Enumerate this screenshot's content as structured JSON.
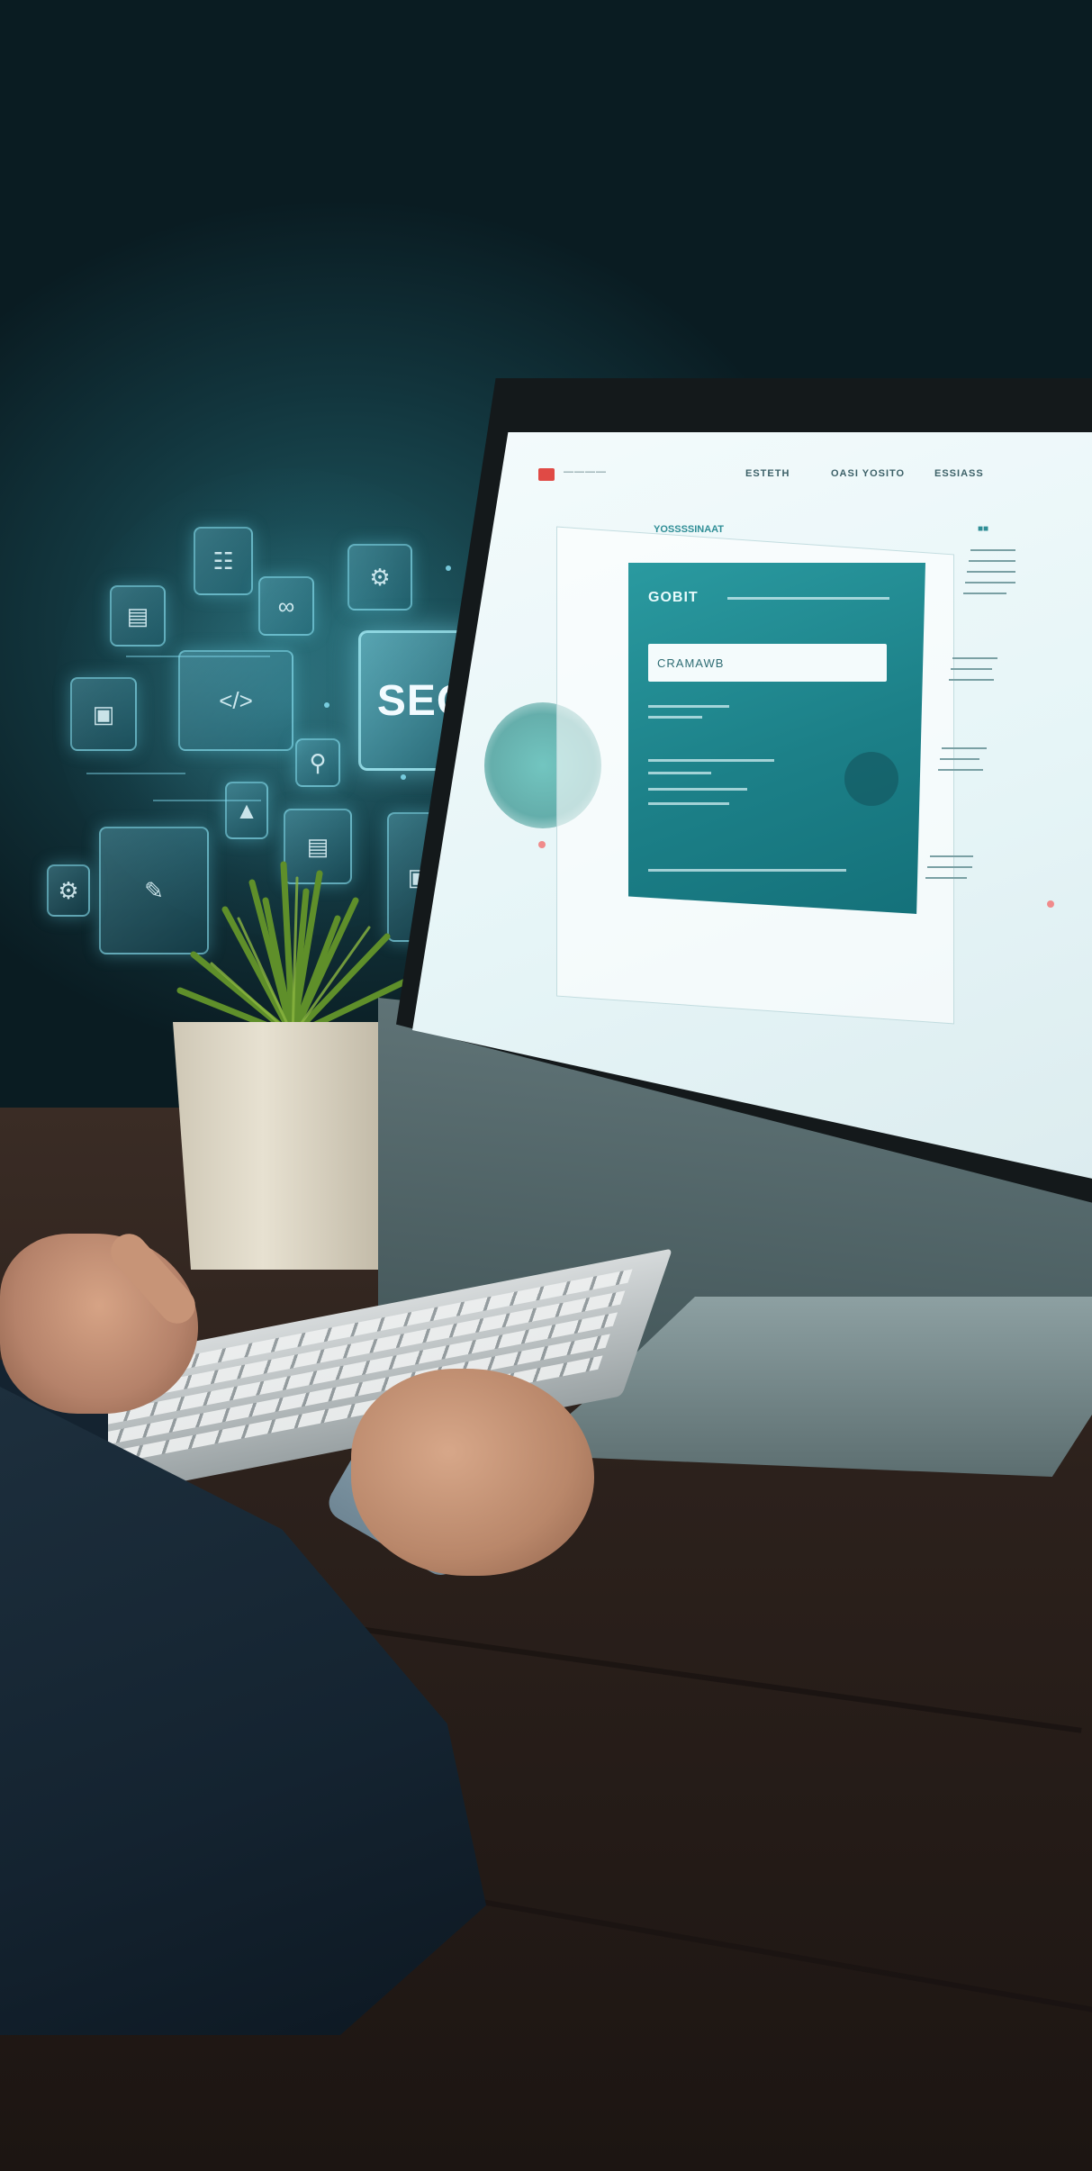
{
  "scene": {
    "description_colors": {
      "wall": "#12353d",
      "hologram": "#8ce6f5",
      "screen_accent": "#1c8088",
      "desk": "#2c211c"
    }
  },
  "hologram": {
    "seo_label": "SEO",
    "icons": [
      "document-icon",
      "chart-icon",
      "link-icon",
      "settings-icon",
      "image-icon",
      "code-icon",
      "search-icon",
      "analytics-icon"
    ]
  },
  "website": {
    "nav": {
      "links": [
        "ESTETH",
        "OASI YOSITO",
        "ESSIASS"
      ]
    },
    "sub_nav": [
      "YOSSSSINAAT"
    ],
    "hero": {
      "title": "GOBIT",
      "search_text": "CRAMAWB"
    }
  }
}
